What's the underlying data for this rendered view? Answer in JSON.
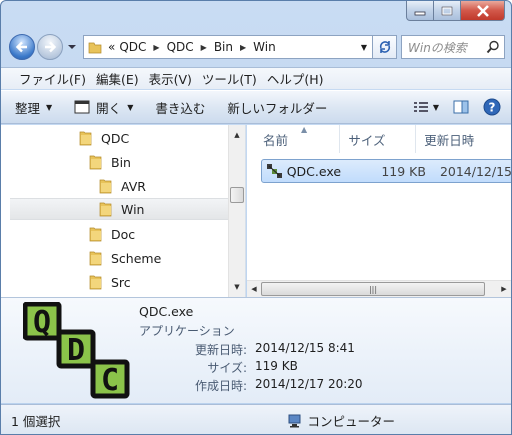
{
  "window": {
    "caption_buttons": [
      "minimize-icon",
      "maximize-icon",
      "close-icon"
    ]
  },
  "address": {
    "overflow": "«",
    "segments": [
      "QDC",
      "QDC",
      "Bin",
      "Win"
    ]
  },
  "search": {
    "placeholder": "Winの検索"
  },
  "menu": [
    "ファイル(F)",
    "編集(E)",
    "表示(V)",
    "ツール(T)",
    "ヘルプ(H)"
  ],
  "toolbar": {
    "organize": "整理",
    "open": "開く",
    "burn": "書き込む",
    "new_folder": "新しいフォルダー"
  },
  "tree": [
    {
      "label": "QDC",
      "level": 0
    },
    {
      "label": "Bin",
      "level": 1
    },
    {
      "label": "AVR",
      "level": 2
    },
    {
      "label": "Win",
      "level": 2,
      "selected": true
    },
    {
      "label": "Doc",
      "level": 1
    },
    {
      "label": "Scheme",
      "level": 1
    },
    {
      "label": "Src",
      "level": 1
    }
  ],
  "columns": {
    "name": "名前",
    "size": "サイズ",
    "modified": "更新日時"
  },
  "files": [
    {
      "name": "QDC.exe",
      "size": "119 KB",
      "modified": "2014/12/15"
    }
  ],
  "details": {
    "filename": "QDC.exe",
    "type": "アプリケーション",
    "modified_label": "更新日時:",
    "modified_value": "2014/12/15 8:41",
    "size_label": "サイズ:",
    "size_value": "119 KB",
    "created_label": "作成日時:",
    "created_value": "2014/12/17 20:20",
    "icon_letters": [
      "Q",
      "D",
      "C"
    ]
  },
  "status": {
    "selection": "1 個選択",
    "location": "コンピューター"
  },
  "colors": {
    "accent": "#3a78c9",
    "selection": "#c1dcfc",
    "folder": "#e8c35a"
  }
}
